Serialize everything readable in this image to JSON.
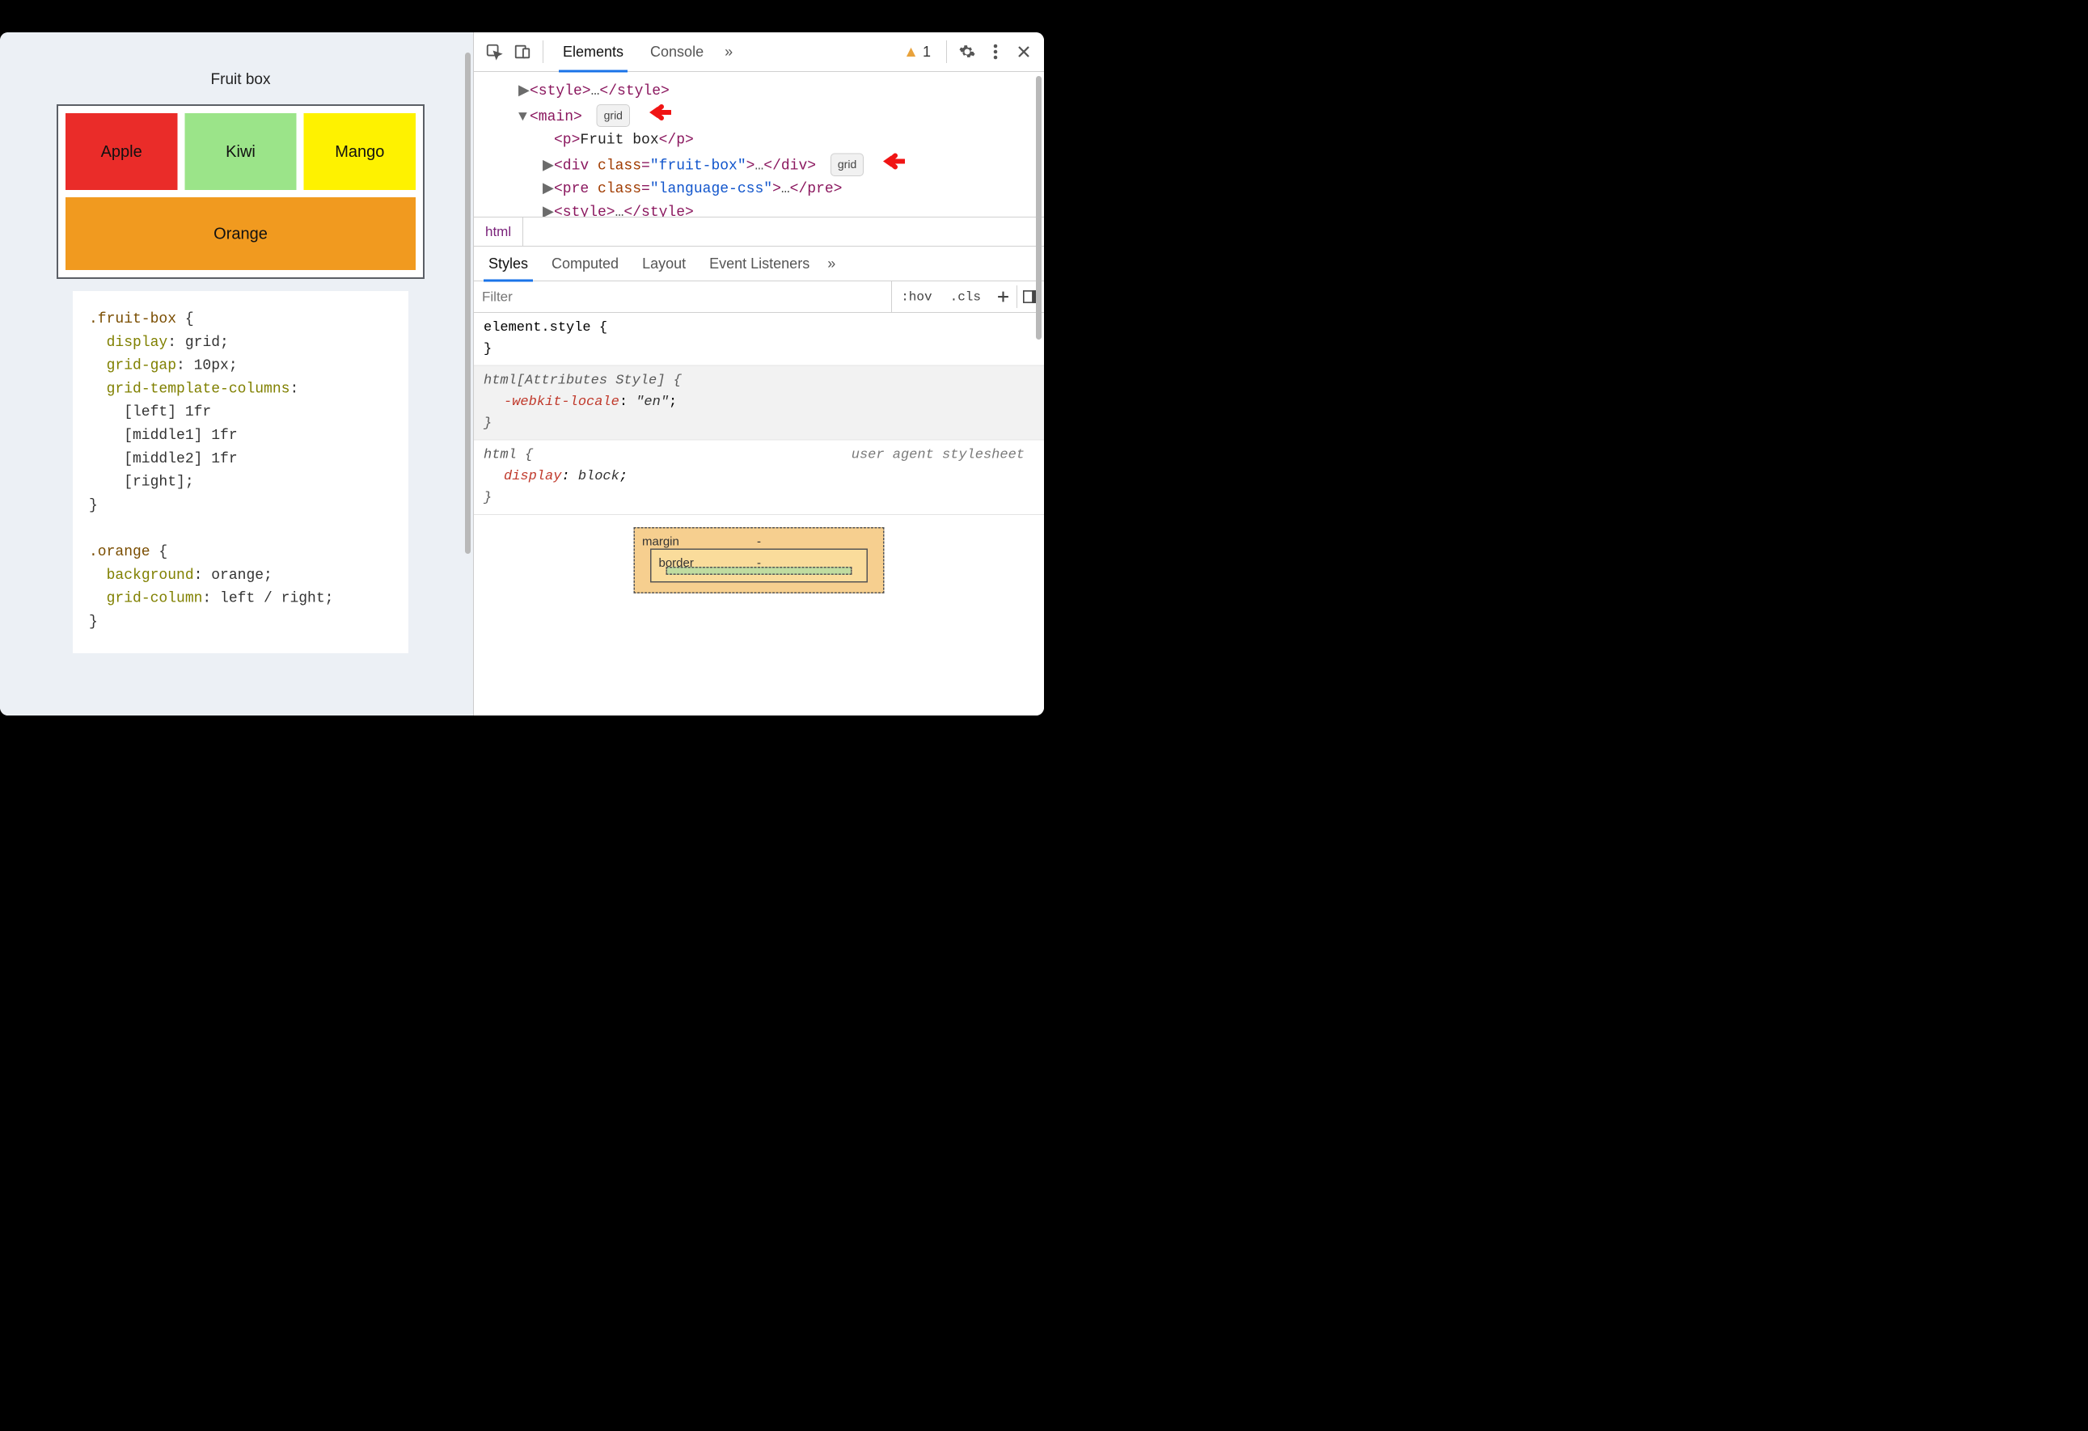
{
  "preview": {
    "title": "Fruit box",
    "fruits": {
      "apple": "Apple",
      "kiwi": "Kiwi",
      "mango": "Mango",
      "orange": "Orange"
    },
    "code_lines": [
      {
        "sel": ".fruit-box",
        "open": " {"
      },
      {
        "prop": "display",
        "val": "grid"
      },
      {
        "prop": "grid-gap",
        "val": "10px"
      },
      {
        "prop": "grid-template-columns",
        "val_after": ":"
      },
      {
        "raw": "    [left] 1fr"
      },
      {
        "raw": "    [middle1] 1fr"
      },
      {
        "raw": "    [middle2] 1fr"
      },
      {
        "raw": "    [right];"
      },
      {
        "close": "}"
      },
      {
        "blank": true
      },
      {
        "sel": ".orange",
        "open": " {"
      },
      {
        "prop": "background",
        "val": "orange"
      },
      {
        "prop": "grid-column",
        "val": "left / right"
      },
      {
        "close": "}"
      }
    ]
  },
  "devtools": {
    "tabs": {
      "elements": "Elements",
      "console": "Console",
      "more": "»"
    },
    "warning_count": "1",
    "dom": {
      "style_open": "<style>",
      "style_ell": "…",
      "style_close": "</style>",
      "main_open": "<main>",
      "p_open": "<p>",
      "p_text": "Fruit box",
      "p_close": "</p>",
      "div_open_pre": "<div ",
      "div_class_attr": "class",
      "div_class_val": "\"fruit-box\"",
      "div_open_post": ">",
      "div_ell": "…",
      "div_close": "</div>",
      "pre_open_pre": "<pre ",
      "pre_class_attr": "class",
      "pre_class_val": "\"language-css\"",
      "pre_open_post": ">",
      "pre_ell": "…",
      "pre_close": "</pre>",
      "style2_open": "<style>",
      "style2_ell": "…",
      "style2_close": "</style>",
      "grid_badge": "grid"
    },
    "crumb": "html",
    "styles_tabs": {
      "styles": "Styles",
      "computed": "Computed",
      "layout": "Layout",
      "listeners": "Event Listeners",
      "more": "»"
    },
    "filter": {
      "placeholder": "Filter",
      "hov": ":hov",
      "cls": ".cls"
    },
    "rules": {
      "elstyle_sel": "element.style",
      "htmlattr_sel": "html[Attributes Style]",
      "htmlattr_prop": "-webkit-locale",
      "htmlattr_val": "\"en\"",
      "html_sel": "html",
      "html_src": "user agent stylesheet",
      "html_prop": "display",
      "html_val": "block",
      "open": " {",
      "close": "}",
      "semi": ";"
    },
    "boxmodel": {
      "margin": "margin",
      "border": "border",
      "dash": "-"
    }
  }
}
